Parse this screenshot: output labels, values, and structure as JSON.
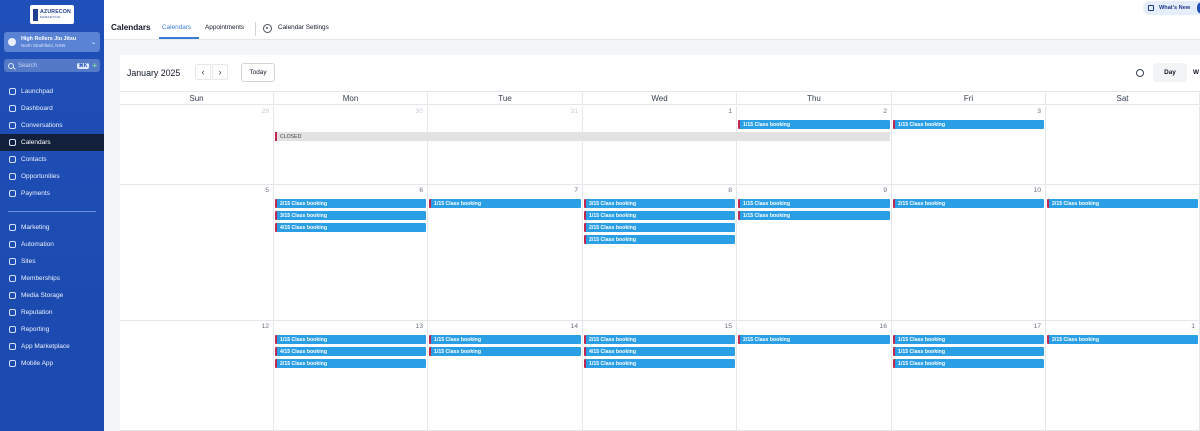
{
  "logo": {
    "line1": "AZURECON",
    "line2": "MARKETING"
  },
  "account": {
    "name": "High Rollers Jiu Jitsu",
    "location": "North Strathfield, NSW"
  },
  "search": {
    "placeholder": "Search",
    "shortcut": "⌘K"
  },
  "sidebar": {
    "primary": [
      {
        "label": "Launchpad",
        "icon": "rocket-icon"
      },
      {
        "label": "Dashboard",
        "icon": "dashboard-icon"
      },
      {
        "label": "Conversations",
        "icon": "chat-icon"
      },
      {
        "label": "Calendars",
        "icon": "calendar-icon",
        "active": true
      },
      {
        "label": "Contacts",
        "icon": "contacts-icon"
      },
      {
        "label": "Opportunities",
        "icon": "opportunities-icon"
      },
      {
        "label": "Payments",
        "icon": "payments-icon"
      }
    ],
    "secondary": [
      {
        "label": "Marketing",
        "icon": "megaphone-icon"
      },
      {
        "label": "Automation",
        "icon": "automation-icon"
      },
      {
        "label": "Sites",
        "icon": "globe-icon"
      },
      {
        "label": "Memberships",
        "icon": "memberships-icon"
      },
      {
        "label": "Media Storage",
        "icon": "folder-icon"
      },
      {
        "label": "Reputation",
        "icon": "star-icon"
      },
      {
        "label": "Reporting",
        "icon": "chart-icon"
      },
      {
        "label": "App Marketplace",
        "icon": "grid-icon"
      },
      {
        "label": "Mobile App",
        "icon": "mobile-icon"
      }
    ]
  },
  "header": {
    "title": "Calendars",
    "tabs": {
      "calendars": "Calendars",
      "appointments": "Appointments",
      "settings": "Calendar Settings"
    },
    "whats_new": "What's New"
  },
  "calendar": {
    "month": "January 2025",
    "today_label": "Today",
    "view_day": "Day",
    "view_week": "W",
    "weekdays": [
      "Sun",
      "Mon",
      "Tue",
      "Wed",
      "Thu",
      "Fri",
      "Sat"
    ],
    "closed_label": "CLOSED",
    "weeks": [
      {
        "days": [
          {
            "num": "29",
            "other": true,
            "events": []
          },
          {
            "num": "30",
            "other": true,
            "events": []
          },
          {
            "num": "31",
            "other": true,
            "events": []
          },
          {
            "num": "1",
            "other": false,
            "events": []
          },
          {
            "num": "2",
            "other": false,
            "events": [
              "1/15  Class booking"
            ]
          },
          {
            "num": "3",
            "other": false,
            "events": [
              "1/15  Class booking"
            ]
          },
          {
            "num": "",
            "other": false,
            "events": []
          }
        ]
      },
      {
        "days": [
          {
            "num": "5",
            "other": false,
            "events": []
          },
          {
            "num": "6",
            "other": false,
            "events": [
              "2/15  Class booking",
              "3/15  Class booking",
              "4/15  Class booking"
            ]
          },
          {
            "num": "7",
            "other": false,
            "events": [
              "1/15  Class booking"
            ]
          },
          {
            "num": "8",
            "other": false,
            "events": [
              "3/15  Class booking",
              "1/15  Class booking",
              "2/15  Class booking",
              "2/15  Class booking"
            ]
          },
          {
            "num": "9",
            "other": false,
            "events": [
              "1/15  Class booking",
              "1/15  Class booking"
            ]
          },
          {
            "num": "10",
            "other": false,
            "events": [
              "2/15  Class booking"
            ]
          },
          {
            "num": "",
            "other": false,
            "events": [
              "2/15  Class booking"
            ]
          }
        ]
      },
      {
        "days": [
          {
            "num": "12",
            "other": false,
            "events": []
          },
          {
            "num": "13",
            "other": false,
            "events": [
              "1/15  Class booking",
              "4/15  Class booking",
              "2/15  Class booking"
            ]
          },
          {
            "num": "14",
            "other": false,
            "events": [
              "1/15  Class booking",
              "1/15  Class booking"
            ]
          },
          {
            "num": "15",
            "other": false,
            "events": [
              "2/15  Class booking",
              "4/15  Class booking",
              "1/15  Class booking"
            ]
          },
          {
            "num": "16",
            "other": false,
            "events": [
              "2/15  Class booking"
            ]
          },
          {
            "num": "17",
            "other": false,
            "events": [
              "1/15  Class booking",
              "1/15  Class booking",
              "1/15  Class booking"
            ]
          },
          {
            "num": "1",
            "other": false,
            "events": [
              "2/15  Class booking"
            ]
          }
        ]
      }
    ]
  }
}
